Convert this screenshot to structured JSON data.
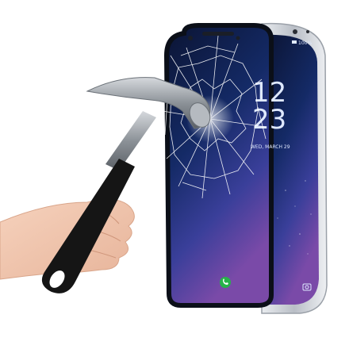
{
  "lockscreen": {
    "hour": "12",
    "minute": "23",
    "date": "WED, MARCH 29",
    "battery": "100%"
  },
  "palette": {
    "glass_edge": "#0b0f18",
    "phone_silver": "#c8ccd3",
    "wallpaper_top": "#0d1635",
    "wallpaper_bottom": "#5a3a8f",
    "call_green": "#27b24a",
    "hammer_head": "#9aa0a6",
    "hammer_grip": "#151515"
  },
  "icons": [
    "phone-call-icon",
    "camera-icon",
    "battery-icon",
    "signal-icon"
  ]
}
